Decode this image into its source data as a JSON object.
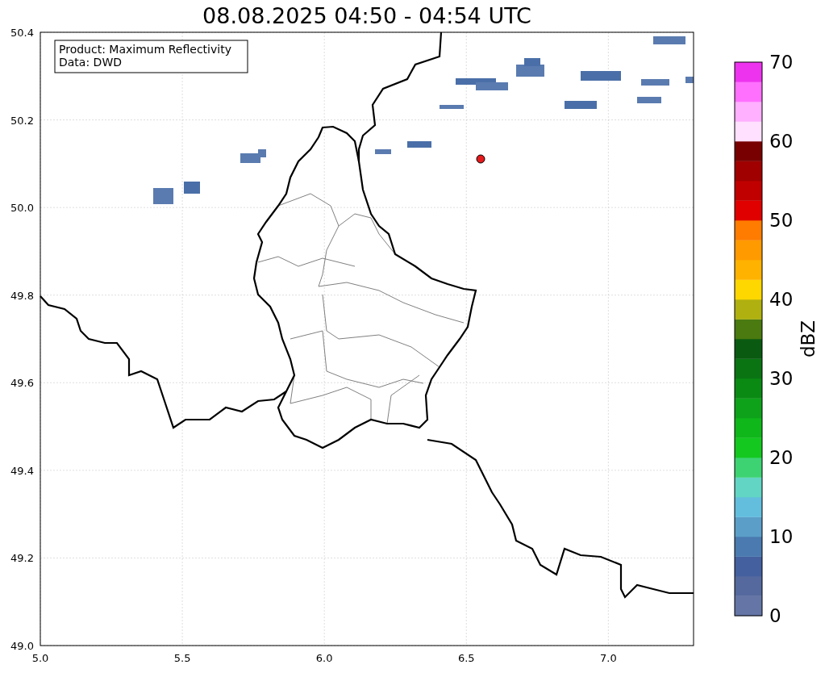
{
  "figure": {
    "title": "08.08.2025 04:50 - 04:54 UTC"
  },
  "map": {
    "info_lines": [
      "Product: Maximum Reflectivity",
      "Data: DWD"
    ],
    "grid": true,
    "y_ticks": [
      "50.4",
      "50.2",
      "50.0",
      "49.8",
      "49.6",
      "49.4",
      "49.2",
      "49.0"
    ],
    "x_ticks": [
      "5.0",
      "5.5",
      "6.0",
      "6.5",
      "7.0"
    ]
  },
  "colorbar": {
    "label": "dBZ",
    "ticks": [
      "70",
      "60",
      "50",
      "40",
      "30",
      "20",
      "10",
      "0"
    ]
  }
}
